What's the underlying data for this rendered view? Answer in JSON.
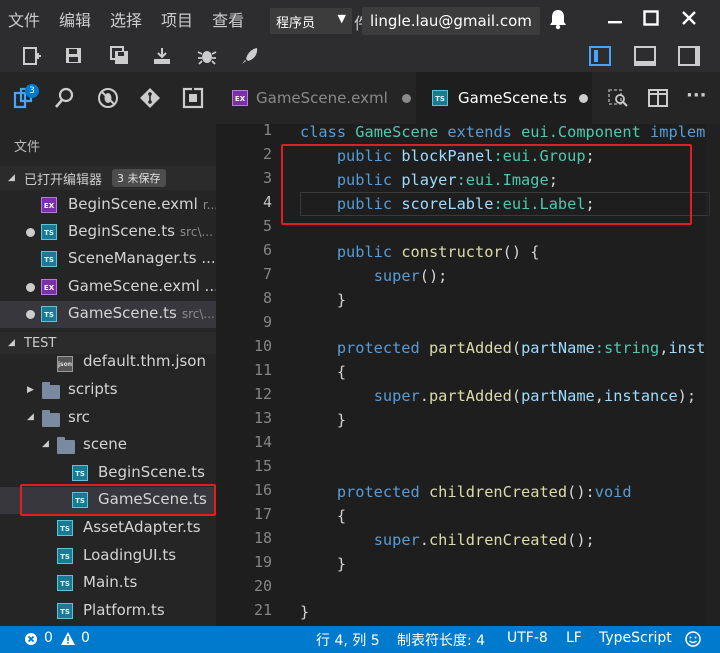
{
  "menu": [
    "文件",
    "编辑",
    "选择",
    "项目",
    "查看"
  ],
  "role_select": {
    "value": "程序员"
  },
  "behind_text": "件",
  "account_email": "lingle.lau@gmail.com",
  "activity_badge": "3",
  "tabs": [
    {
      "label": "GameScene.exml",
      "icon": "EX",
      "state": "inactive",
      "dirty": true
    },
    {
      "label": "GameScene.ts",
      "icon": "TS",
      "state": "active",
      "dirty": true
    }
  ],
  "sidebar": {
    "title": "文件",
    "open_editors": {
      "header": "已打开编辑器",
      "badge": "3 未保存",
      "items": [
        {
          "name": "BeginScene.exml",
          "desc": "r...",
          "icon": "EX",
          "dirty": false
        },
        {
          "name": "BeginScene.ts",
          "desc": "src\\...",
          "icon": "TS",
          "dirty": true
        },
        {
          "name": "SceneManager.ts ...",
          "desc": "",
          "icon": "TS",
          "dirty": false
        },
        {
          "name": "GameScene.exml ...",
          "desc": "",
          "icon": "EX",
          "dirty": true
        },
        {
          "name": "GameScene.ts",
          "desc": "src\\...",
          "icon": "TS",
          "dirty": true
        }
      ]
    },
    "project": {
      "header": "TEST",
      "items": [
        {
          "name": "default.thm.json",
          "type": "json"
        },
        {
          "name": "scripts",
          "type": "folder"
        },
        {
          "name": "src",
          "type": "folder"
        },
        {
          "name": "scene",
          "type": "folder"
        },
        {
          "name": "BeginScene.ts",
          "type": "ts"
        },
        {
          "name": "GameScene.ts",
          "type": "ts"
        },
        {
          "name": "AssetAdapter.ts",
          "type": "ts"
        },
        {
          "name": "LoadingUI.ts",
          "type": "ts"
        },
        {
          "name": "Main.ts",
          "type": "ts"
        },
        {
          "name": "Platform.ts",
          "type": "ts"
        }
      ]
    }
  },
  "editor": {
    "line_numbers": [
      "1",
      "2",
      "3",
      "4",
      "5",
      "6",
      "7",
      "8",
      "9",
      "10",
      "11",
      "12",
      "13",
      "14",
      "15",
      "16",
      "17",
      "18",
      "19",
      "20",
      "21"
    ],
    "code": {
      "l1": {
        "kw": "class",
        "name": "GameScene",
        "kw2": "extends",
        "base": "eui.Component",
        "kw3": "implem"
      },
      "l2": {
        "indent": "    ",
        "kw": "public",
        "name": "blockPanel",
        "type": ":eui.Group",
        "end": ";"
      },
      "l3": {
        "indent": "    ",
        "kw": "public",
        "name": "player",
        "type": ":eui.Image",
        "end": ";"
      },
      "l4": {
        "indent": "    ",
        "kw": "public",
        "name": "scoreLable",
        "type": ":eui.Label",
        "end": ";"
      },
      "l6": {
        "indent": "    ",
        "kw": "public",
        "fn": "constructor",
        "rest": "() {"
      },
      "l7": {
        "indent": "        ",
        "kw": "super",
        "rest": "();"
      },
      "l8": {
        "text": "    }"
      },
      "l10": {
        "indent": "    ",
        "kw": "protected",
        "fn": "partAdded",
        "open": "(",
        "p1": "partName",
        "t1": ":string",
        "comma": ",",
        "p2": "inst"
      },
      "l11": {
        "text": "    {"
      },
      "l12": {
        "indent": "        ",
        "kw": "super",
        "dot": ".",
        "fn": "partAdded",
        "open": "(",
        "p1": "partName",
        "comma": ",",
        "p2": "instance",
        "close": ");"
      },
      "l13": {
        "text": "    }"
      },
      "l16": {
        "indent": "    ",
        "kw": "protected",
        "fn": "childrenCreated",
        "rest": "():",
        "t": "void"
      },
      "l17": {
        "text": "    {"
      },
      "l18": {
        "indent": "        ",
        "kw": "super",
        "dot": ".",
        "fn": "childrenCreated",
        "close": "();"
      },
      "l19": {
        "text": "    }"
      },
      "l21": {
        "text": "}"
      }
    }
  },
  "status": {
    "errors": "0",
    "warnings": "0",
    "position": "行 4, 列 5",
    "tab_size": "制表符长度: 4",
    "encoding": "UTF-8",
    "eol": "LF",
    "language": "TypeScript"
  },
  "colors": {
    "annotation_red": "#e02020",
    "status_bar": "#007acc",
    "keyword": "#569cd6",
    "type": "#4ec9b0",
    "identifier": "#9cdcfe",
    "function": "#dcdcaa"
  }
}
